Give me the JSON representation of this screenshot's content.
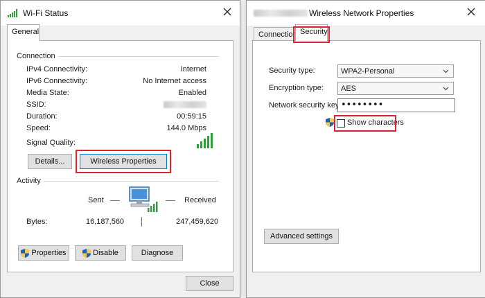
{
  "wifi_status": {
    "title": "Wi-Fi Status",
    "tabs": [
      {
        "label": "General"
      }
    ],
    "connection": {
      "heading": "Connection",
      "rows": [
        {
          "label": "IPv4 Connectivity:",
          "value": "Internet"
        },
        {
          "label": "IPv6 Connectivity:",
          "value": "No Internet access"
        },
        {
          "label": "Media State:",
          "value": "Enabled"
        },
        {
          "label": "SSID:",
          "value": ""
        },
        {
          "label": "Duration:",
          "value": "00:59:15"
        },
        {
          "label": "Speed:",
          "value": "144.0 Mbps"
        }
      ],
      "signal_label": "Signal Quality:",
      "signal_bars": 5,
      "details_button": "Details...",
      "wireless_properties_button": "Wireless Properties"
    },
    "activity": {
      "heading": "Activity",
      "sent_label": "Sent",
      "received_label": "Received",
      "bytes_label": "Bytes:",
      "bytes_sent": "16,187,560",
      "bytes_received": "247,459,620"
    },
    "buttons": {
      "properties": "Properties",
      "disable": "Disable",
      "diagnose": "Diagnose",
      "close": "Close"
    }
  },
  "wireless_properties": {
    "title": "Wireless Network Properties",
    "tabs": [
      {
        "label": "Connection"
      },
      {
        "label": "Security"
      }
    ],
    "security_type_label": "Security type:",
    "security_type_value": "WPA2-Personal",
    "encryption_type_label": "Encryption type:",
    "encryption_type_value": "AES",
    "network_key_label": "Network security key",
    "network_key_value": "••••••••",
    "show_characters_label": "Show characters",
    "show_characters_checked": false,
    "advanced_settings_button": "Advanced settings"
  },
  "colors": {
    "highlight": "#d9232d",
    "signal": "#2e9e3b",
    "focus": "#0078d7"
  },
  "icons": [
    "wifi-icon",
    "close-icon",
    "network-computer-icon",
    "shield-icon",
    "chevron-down-icon",
    "signal-bars-icon"
  ]
}
